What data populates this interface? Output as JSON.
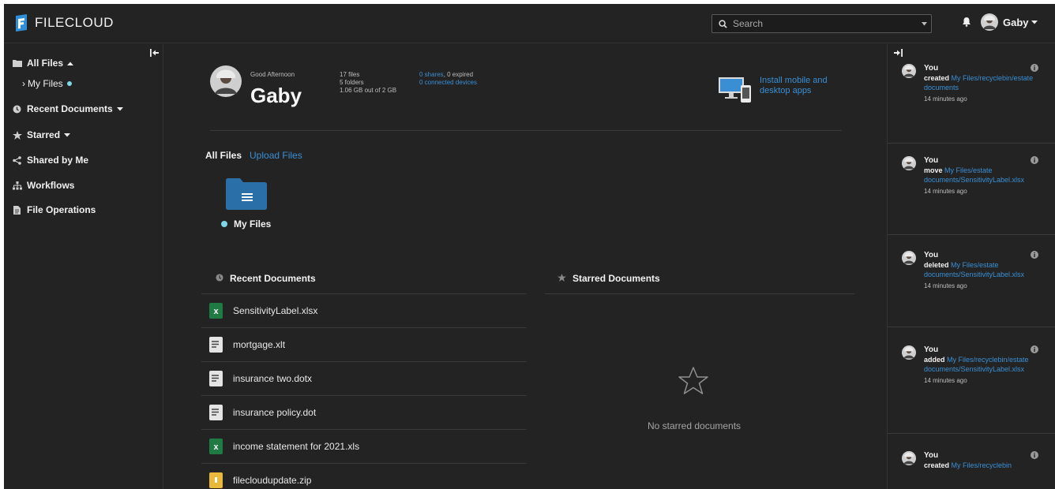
{
  "brand": {
    "name": "FILECLOUD"
  },
  "search": {
    "placeholder": "Search"
  },
  "user": {
    "name": "Gaby"
  },
  "sidebar": {
    "items": [
      {
        "label": "All Files",
        "icon": "folder-icon"
      },
      {
        "label": "My Files"
      },
      {
        "label": "Recent Documents",
        "icon": "clock-icon"
      },
      {
        "label": "Starred",
        "icon": "star-icon"
      },
      {
        "label": "Shared by Me",
        "icon": "share-icon"
      },
      {
        "label": "Workflows",
        "icon": "workflow-icon"
      },
      {
        "label": "File Operations",
        "icon": "file-icon"
      }
    ]
  },
  "dashboard": {
    "greeting": "Good Afternoon",
    "name": "Gaby",
    "files": "17 files",
    "folders": "5 folders",
    "storage": "1.06 GB out of 2 GB",
    "shares_link": "0 shares",
    "expired": ", 0 expired",
    "devices_link": "0 connected devices",
    "install_text": "Install mobile and desktop apps"
  },
  "tabs": {
    "all_files": "All Files",
    "upload_files": "Upload Files"
  },
  "folder": {
    "label": "My Files"
  },
  "recent": {
    "title": "Recent Documents",
    "docs": [
      {
        "name": "SensitivityLabel.xlsx",
        "type": "excel"
      },
      {
        "name": "mortgage.xlt",
        "type": "doc"
      },
      {
        "name": "insurance two.dotx",
        "type": "doc"
      },
      {
        "name": "insurance policy.dot",
        "type": "doc"
      },
      {
        "name": "income statement for 2021.xls",
        "type": "excel"
      },
      {
        "name": "filecloudupdate.zip",
        "type": "zip"
      }
    ]
  },
  "starred": {
    "title": "Starred Documents",
    "empty": "No starred documents"
  },
  "activity": [
    {
      "user": "You",
      "verb": "created",
      "path": "My Files/recyclebin/estate documents",
      "time": "14 minutes ago"
    },
    {
      "user": "You",
      "verb": "move",
      "path": "My Files/estate documents/SensitivityLabel.xlsx",
      "time": "14 minutes ago"
    },
    {
      "user": "You",
      "verb": "deleted",
      "path": "My Files/estate documents/SensitivityLabel.xlsx",
      "time": "14 minutes ago"
    },
    {
      "user": "You",
      "verb": "added",
      "path": "My Files/recyclebin/estate documents/SensitivityLabel.xlsx",
      "time": "14 minutes ago"
    },
    {
      "user": "You",
      "verb": "created",
      "path": "My Files/recyclebin",
      "time": ""
    }
  ],
  "colors": {
    "background": "#232323",
    "link": "#3a8fd4",
    "accent_dot": "#7fd8e8",
    "folder": "#2a6fa8"
  }
}
